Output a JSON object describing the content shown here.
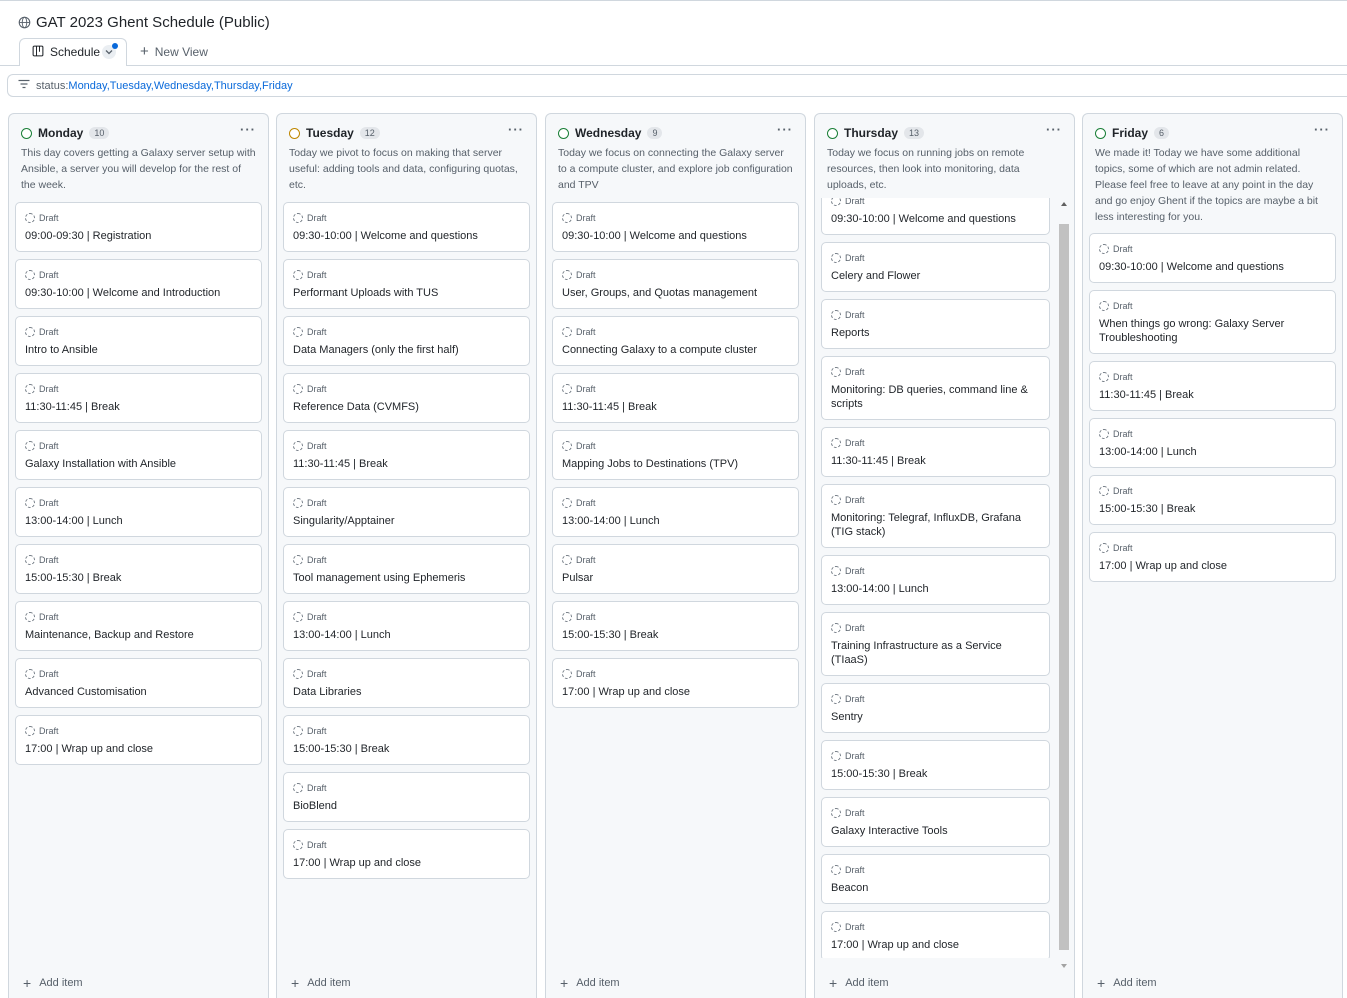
{
  "page": {
    "title": "GAT 2023 Ghent Schedule (Public)"
  },
  "tabs": {
    "active": "Schedule",
    "new_view": "New View"
  },
  "filter": {
    "key": "status:",
    "values": [
      "Monday",
      "Tuesday",
      "Wednesday",
      "Thursday",
      "Friday"
    ]
  },
  "add_item_label": "Add item",
  "draft_label": "Draft",
  "columns": [
    {
      "name": "Monday",
      "count": "10",
      "status_color": "#1a7f37",
      "description": "This day covers getting a Galaxy server setup with Ansible, a server you will develop for the rest of the week.",
      "items": [
        "09:00-09:30 | Registration",
        "09:30-10:00 | Welcome and Introduction",
        "Intro to Ansible",
        "11:30-11:45 | Break",
        "Galaxy Installation with Ansible",
        "13:00-14:00 | Lunch",
        "15:00-15:30 | Break",
        "Maintenance, Backup and Restore",
        "Advanced Customisation",
        "17:00 | Wrap up and close"
      ]
    },
    {
      "name": "Tuesday",
      "count": "12",
      "status_color": "#bf8700",
      "description": "Today we pivot to focus on making that server useful: adding tools and data, configuring quotas, etc.",
      "items": [
        "09:30-10:00 | Welcome and questions",
        "Performant Uploads with TUS",
        "Data Managers (only the first half)",
        "Reference Data (CVMFS)",
        "11:30-11:45 | Break",
        "Singularity/Apptainer",
        "Tool management using Ephemeris",
        "13:00-14:00 | Lunch",
        "Data Libraries",
        "15:00-15:30 | Break",
        "BioBlend",
        "17:00 | Wrap up and close"
      ]
    },
    {
      "name": "Wednesday",
      "count": "9",
      "status_color": "#1a7f37",
      "description": "Today we focus on connecting the Galaxy server to a compute cluster, and explore job configuration and TPV",
      "items": [
        "09:30-10:00 | Welcome and questions",
        "User, Groups, and Quotas management",
        "Connecting Galaxy to a compute cluster",
        "11:30-11:45 | Break",
        "Mapping Jobs to Destinations (TPV)",
        "13:00-14:00 | Lunch",
        "Pulsar",
        "15:00-15:30 | Break",
        "17:00 | Wrap up and close"
      ]
    },
    {
      "name": "Thursday",
      "count": "13",
      "status_color": "#1a7f37",
      "description": "Today we focus on running jobs on remote resources, then look into monitoring, data uploads, etc.",
      "items": [
        "09:30-10:00 | Welcome and questions",
        "Celery and Flower",
        "Reports",
        "Monitoring: DB queries, command line & scripts",
        "11:30-11:45 | Break",
        "Monitoring: Telegraf, InfluxDB, Grafana (TIG stack)",
        "13:00-14:00 | Lunch",
        "Training Infrastructure as a Service (TIaaS)",
        "Sentry",
        "15:00-15:30 | Break",
        "Galaxy Interactive Tools",
        "Beacon",
        "17:00 | Wrap up and close"
      ]
    },
    {
      "name": "Friday",
      "count": "6",
      "status_color": "#1a7f37",
      "description": "We made it! Today we have some additional topics, some of which are not admin related. Please feel free to leave at any point in the day and go enjoy Ghent if the topics are maybe a bit less interesting for you.",
      "items": [
        "09:30-10:00 | Welcome and questions",
        "When things go wrong: Galaxy Server Troubleshooting",
        "11:30-11:45 | Break",
        "13:00-14:00 | Lunch",
        "15:00-15:30 | Break",
        "17:00 | Wrap up and close"
      ]
    }
  ]
}
